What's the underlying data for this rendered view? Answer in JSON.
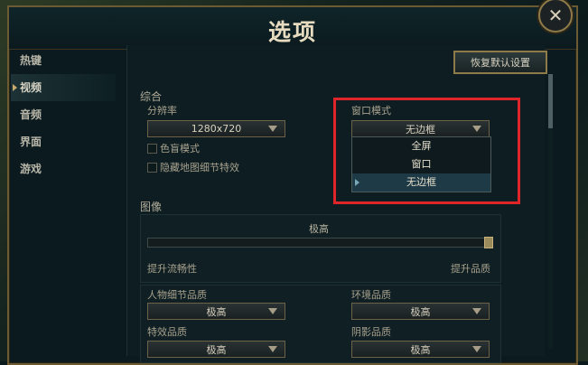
{
  "window": {
    "title": "选项",
    "close_symbol": "✕"
  },
  "sidebar": {
    "items": [
      {
        "label": "热键"
      },
      {
        "label": "视频"
      },
      {
        "label": "音频"
      },
      {
        "label": "界面"
      },
      {
        "label": "游戏"
      }
    ],
    "active_index": 1
  },
  "toolbar": {
    "reset_label": "恢复默认设置"
  },
  "general": {
    "section_title": "综合",
    "resolution_label": "分辨率",
    "resolution_value": "1280x720",
    "colorblind_label": "色盲模式",
    "hide_eyecandy_label": "隐藏地图细节特效",
    "window_mode_label": "窗口模式",
    "window_mode_value": "无边框",
    "window_mode_options": [
      "全屏",
      "窗口",
      "无边框"
    ],
    "window_mode_selected_index": 2
  },
  "graphics": {
    "section_title": "图像",
    "preset_value": "极高",
    "slider_left_label": "提升流畅性",
    "slider_right_label": "提升品质",
    "slider_level": 1.0
  },
  "quality": {
    "character_label": "人物细节品质",
    "character_value": "极高",
    "environment_label": "环境品质",
    "environment_value": "极高",
    "effects_label": "特效品质",
    "effects_value": "极高",
    "shadow_label": "阴影品质",
    "shadow_value": "极高"
  },
  "colors": {
    "highlight_border": "#e0252a",
    "accent_gold": "#c8aa6e"
  }
}
